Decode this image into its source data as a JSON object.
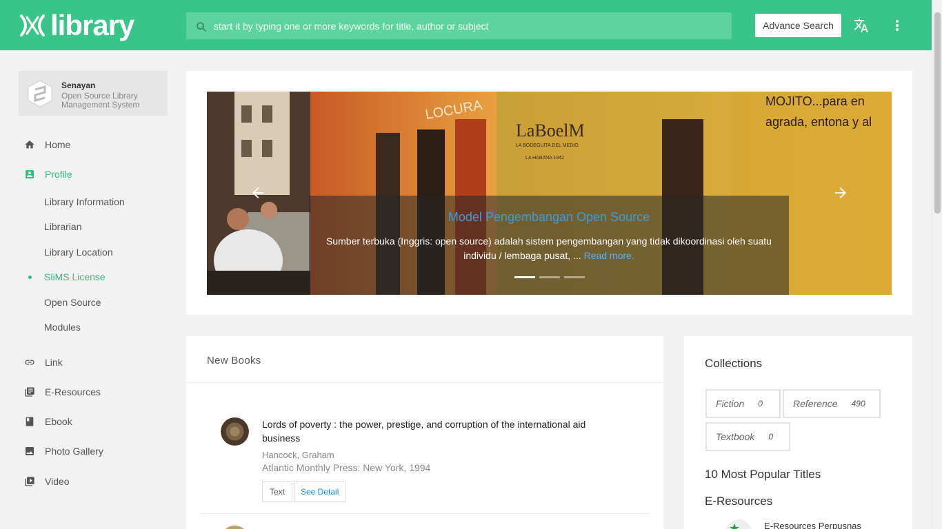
{
  "header": {
    "logo_text": "library",
    "search": {
      "placeholder": "start it by typing one or more keywords for title, author or subject"
    },
    "advance_search_label": "Advance Search"
  },
  "brand": {
    "name": "Senayan",
    "subtitle": "Open Source Library Management System"
  },
  "sidebar": {
    "items": [
      {
        "label": "Home",
        "icon": "home-icon"
      },
      {
        "label": "Profile",
        "icon": "profile-icon",
        "active": true
      },
      {
        "label": "Link",
        "icon": "link-icon"
      },
      {
        "label": "E-Resources",
        "icon": "e-resources-icon"
      },
      {
        "label": "Ebook",
        "icon": "ebook-icon"
      },
      {
        "label": "Photo Gallery",
        "icon": "photo-gallery-icon"
      },
      {
        "label": "Video",
        "icon": "video-icon"
      }
    ],
    "profile_sub": [
      {
        "label": "Library Information"
      },
      {
        "label": "Librarian"
      },
      {
        "label": "Library Location"
      },
      {
        "label": "SliMS License",
        "active": true
      },
      {
        "label": "Open Source"
      },
      {
        "label": "Modules"
      }
    ]
  },
  "slider": {
    "title": "Model Pengembangan Open Source",
    "text": "Sumber terbuka (Inggris: open source) adalah sistem pengembangan yang tidak dikoordinasi oleh suatu individu / lembaga pusat, ... ",
    "read_more": "Read more.",
    "slide_count": 3,
    "active_index": 0,
    "wall_text_1": "MOJITO...para en",
    "wall_text_2": "agrada, entona y al",
    "sign_main": "LaBoelM",
    "sign_sub_1": "LA BODEGUITA DEL MEDIO",
    "sign_sub_2": "LA HABANA 1942",
    "graffiti": "LOCURA"
  },
  "new_books": {
    "title": "New Books",
    "books": [
      {
        "title": "Lords of poverty : the power, prestige, and corruption of the international aid business",
        "author": "Hancock, Graham",
        "publisher": "Atlantic Monthly Press: New York, 1994",
        "type_label": "Text",
        "detail_label": "See Detail"
      }
    ]
  },
  "collections": {
    "title": "Collections",
    "chips": [
      {
        "label": "Fiction",
        "count": "0"
      },
      {
        "label": "Reference",
        "count": "490"
      },
      {
        "label": "Textbook",
        "count": "0"
      }
    ],
    "popular_title": "10 Most Popular Titles",
    "eresources_title": "E-Resources",
    "eresources_item": "E-Resources Perpusnas"
  },
  "colors": {
    "brand": "#39c48a",
    "accent_text": "#2fbf7f",
    "link": "#1e88e5"
  }
}
